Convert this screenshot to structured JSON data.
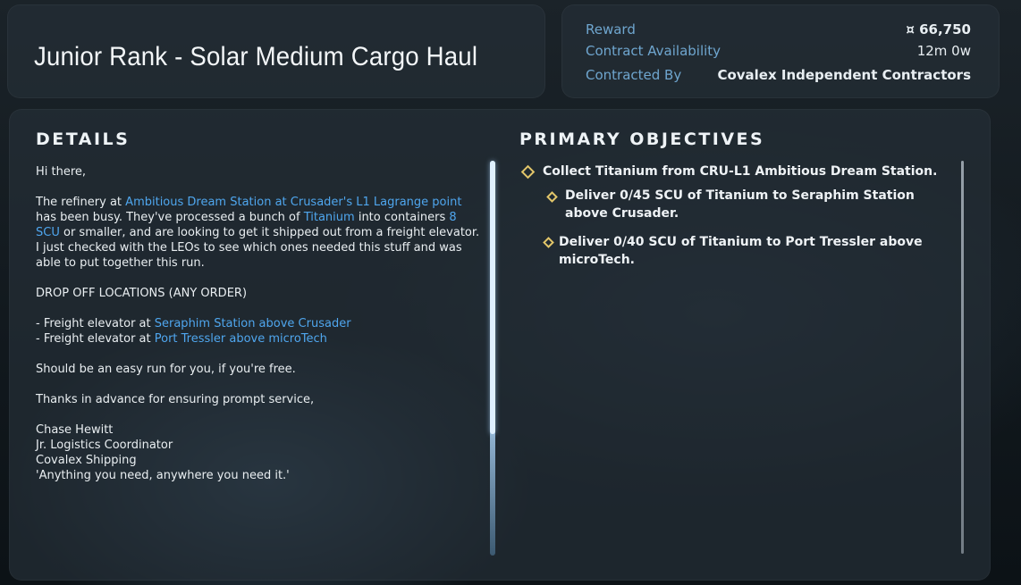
{
  "contract": {
    "title": "Junior Rank - Solar Medium Cargo Haul"
  },
  "info": {
    "reward_label": "Reward",
    "reward_value": "¤ 66,750",
    "availability_label": "Contract Availability",
    "availability_value": "12m 0w",
    "contracted_by_label": "Contracted By",
    "contracted_by_value": "Covalex Independent Contractors"
  },
  "details": {
    "heading": "DETAILS",
    "greeting": "Hi there,",
    "p1_a": "The refinery at ",
    "p1_link1": "Ambitious Dream Station at Crusader's L1 Lagrange point",
    "p1_b": " has been busy. They've processed a bunch of ",
    "p1_link2": "Titanium",
    "p1_c": " into containers ",
    "p1_link3": "8 SCU",
    "p1_d": " or smaller, and are looking to get it shipped out from a freight elevator. I just checked with the LEOs to see which ones needed this stuff and was able to put together this run.",
    "dropoff_heading": "DROP OFF LOCATIONS (ANY ORDER)",
    "drop1_prefix": "- Freight elevator at ",
    "drop1_link": "Seraphim Station above Crusader",
    "drop2_prefix": "- Freight elevator at ",
    "drop2_link": "Port Tressler above microTech",
    "easy_run": "Should be an easy run for you, if you're free.",
    "thanks": "Thanks in advance for ensuring prompt service,",
    "sig_name": "Chase Hewitt",
    "sig_title": "Jr. Logistics Coordinator",
    "sig_company": "Covalex Shipping",
    "sig_motto": "'Anything you need, anywhere you need it.'"
  },
  "objectives": {
    "heading": "PRIMARY OBJECTIVES",
    "main": "Collect Titanium from CRU-L1 Ambitious Dream Station.",
    "sub1": "Deliver 0/45 SCU of Titanium to Seraphim Station above Crusader.",
    "sub2": "Deliver 0/40 SCU of Titanium to Port Tressler above microTech."
  },
  "colors": {
    "link": "#4fa6ee",
    "label": "#6fa6cf",
    "diamond": "#e2c66a"
  }
}
